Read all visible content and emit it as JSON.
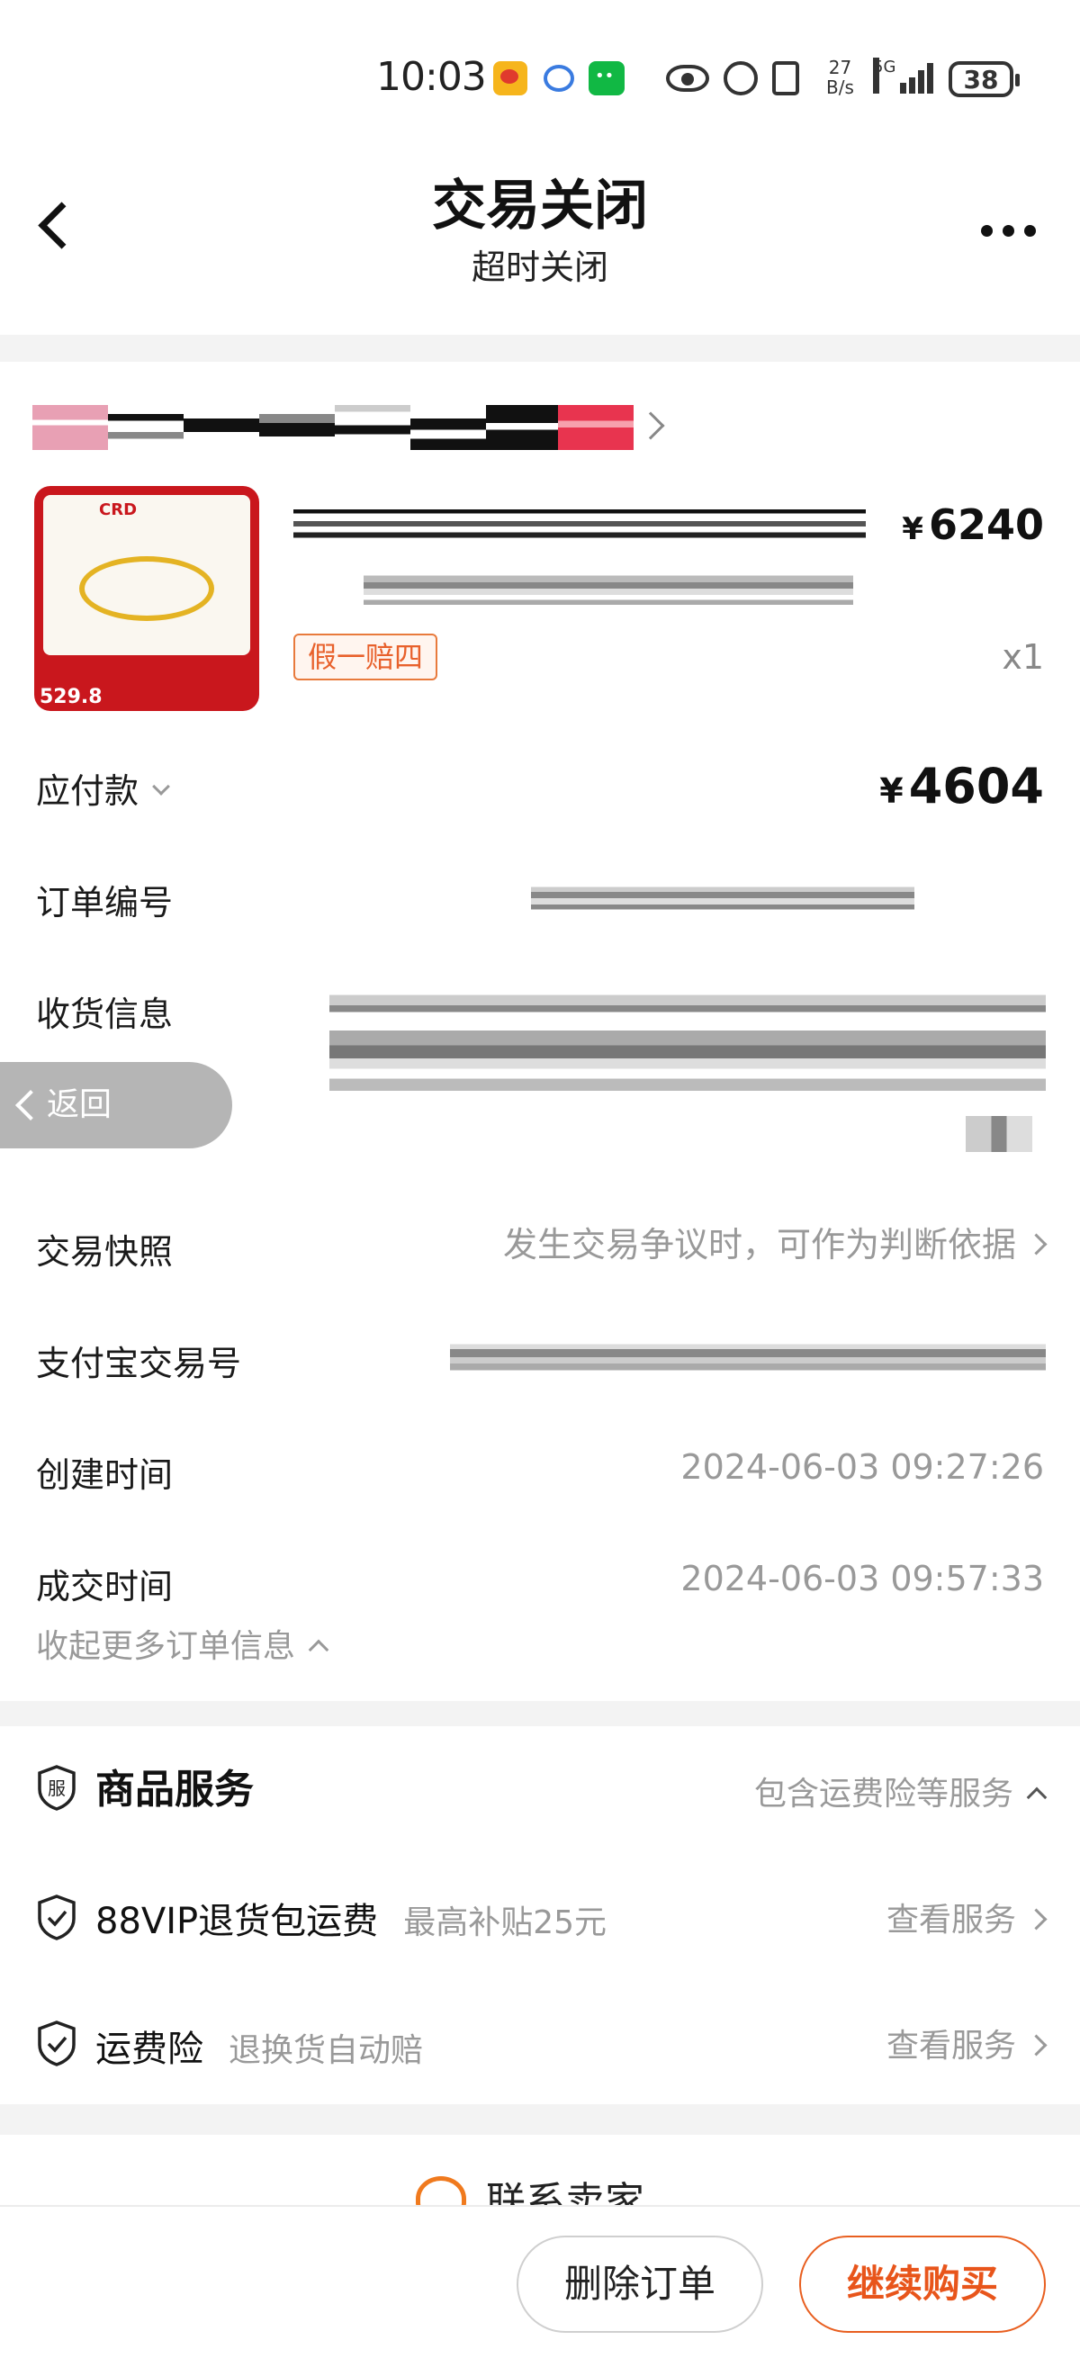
{
  "status_bar": {
    "time": "10:03",
    "net_speed_value": "27",
    "net_speed_unit": "B/s",
    "network": "5G",
    "battery": "38"
  },
  "header": {
    "title": "交易关闭",
    "subtitle": "超时关闭"
  },
  "product": {
    "currency": "¥",
    "price": "6240",
    "quantity": "x1",
    "badge": "假一赔四",
    "image_brand": "CRD",
    "image_price": "529.8"
  },
  "order": {
    "amount_due_label": "应付款",
    "amount_due_currency": "¥",
    "amount_due": "4604",
    "order_no_label": "订单编号",
    "shipping_label": "收货信息",
    "snapshot_label": "交易快照",
    "snapshot_value": "发生交易争议时，可作为判断依据",
    "alipay_label": "支付宝交易号",
    "created_label": "创建时间",
    "created_value": "2024-06-03 09:27:26",
    "deal_label": "成交时间",
    "deal_value": "2024-06-03 09:57:33",
    "collapse_label": "收起更多订单信息"
  },
  "float_back": {
    "label": "返回"
  },
  "services": {
    "title": "商品服务",
    "summary": "包含运费险等服务",
    "items": [
      {
        "name": "88VIP退货包运费",
        "desc": "最高补贴25元",
        "link": "查看服务"
      },
      {
        "name": "运费险",
        "desc": "退换货自动赔",
        "link": "查看服务"
      }
    ]
  },
  "contact": {
    "label": "联系卖家"
  },
  "actions": {
    "delete": "删除订单",
    "continue": "继续购买"
  },
  "colors": {
    "accent": "#e8551b",
    "badge_border": "#e87a3c",
    "muted_text": "#999999",
    "divider": "#f3f3f3"
  }
}
